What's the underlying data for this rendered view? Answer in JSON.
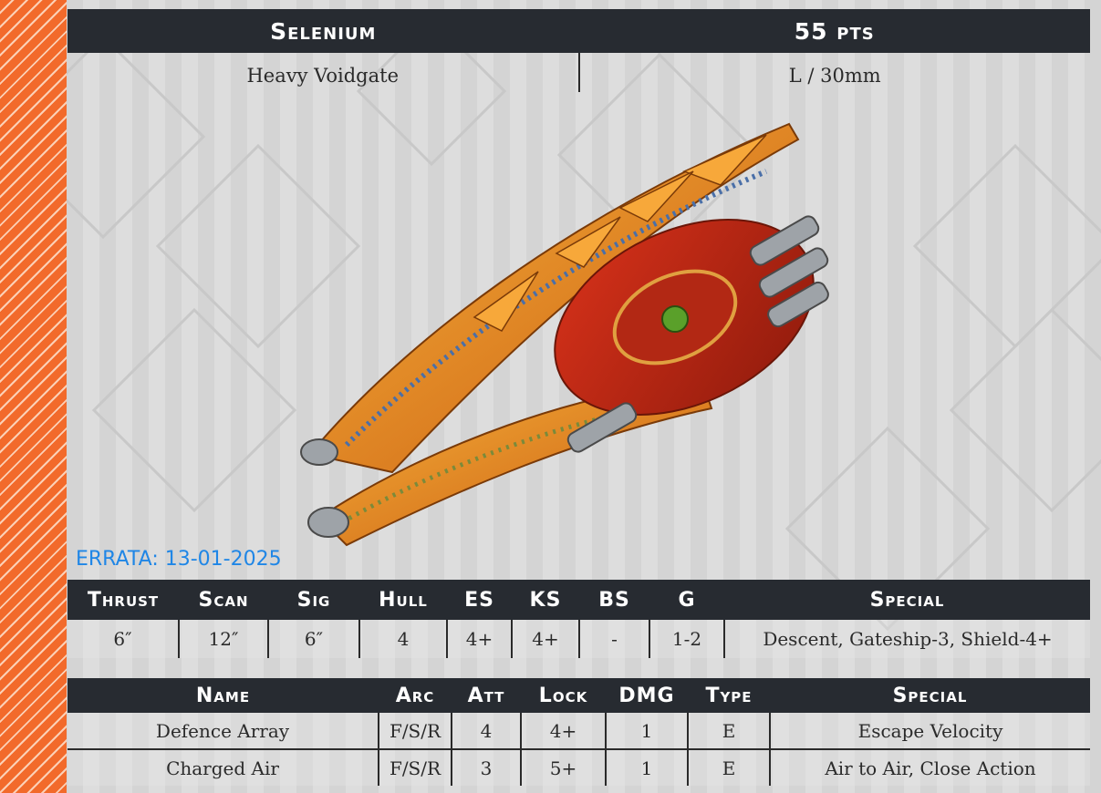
{
  "ship": {
    "name": "Selenium",
    "points": "55 pts",
    "class": "Heavy Voidgate",
    "size": "L / 30mm"
  },
  "errata": "ERRATA: 13-01-2025",
  "stats": {
    "headers": [
      "Thrust",
      "Scan",
      "Sig",
      "Hull",
      "ES",
      "KS",
      "BS",
      "G",
      "Special"
    ],
    "values": [
      "6″",
      "12″",
      "6″",
      "4",
      "4+",
      "4+",
      "-",
      "1-2",
      "Descent, Gateship-3, Shield-4+"
    ]
  },
  "weapons": {
    "headers": [
      "Name",
      "Arc",
      "Att",
      "Lock",
      "DMG",
      "Type",
      "Special"
    ],
    "rows": [
      [
        "Defence Array",
        "F/S/R",
        "4",
        "4+",
        "1",
        "E",
        "Escape Velocity"
      ],
      [
        "Charged Air",
        "F/S/R",
        "3",
        "5+",
        "1",
        "E",
        "Air to Air, Close Action"
      ]
    ]
  },
  "colors": {
    "accent": "#f26a2b",
    "header_bg": "#272b31",
    "errata": "#1f86e6"
  },
  "image": {
    "subject": "ship-miniature"
  }
}
